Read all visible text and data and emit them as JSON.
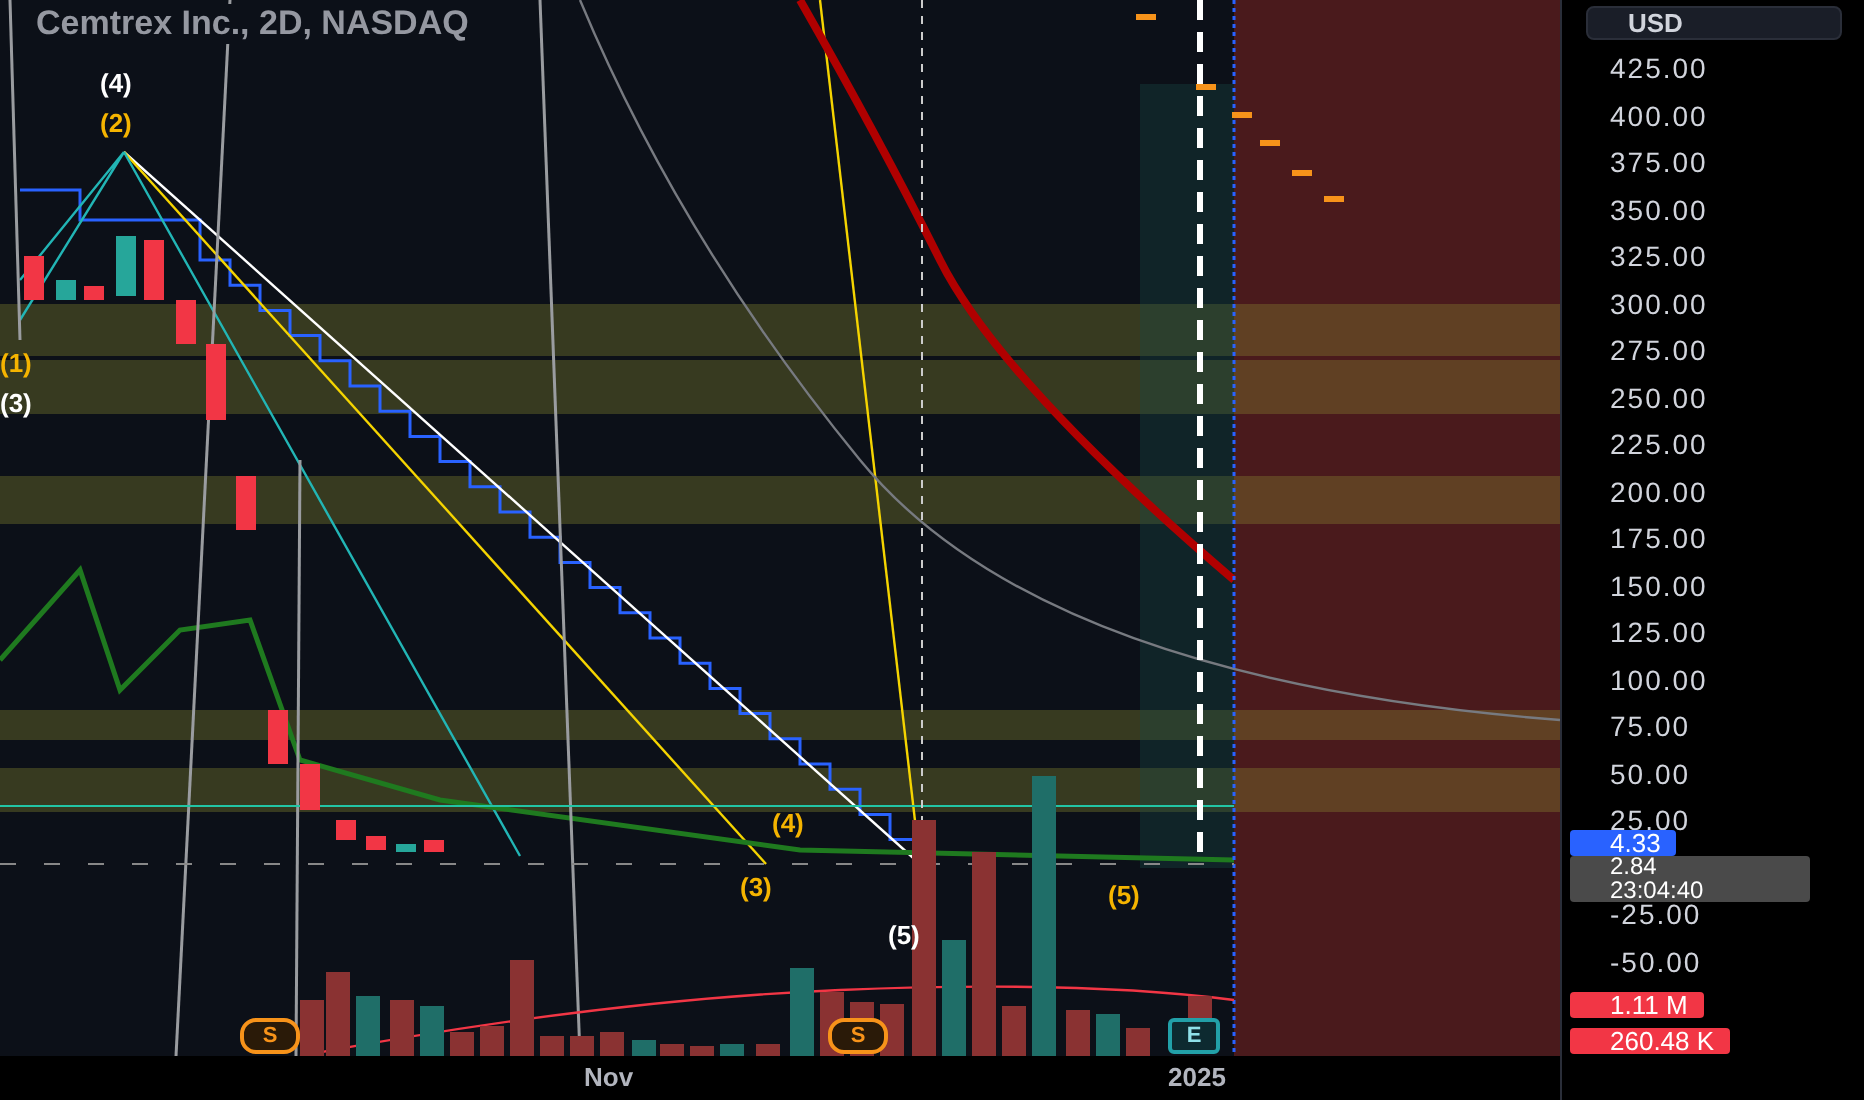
{
  "chart": {
    "title": "Cemtrex Inc., 2D, NASDAQ",
    "wave_labels": [
      {
        "text": "(4)",
        "color": "#ffffff"
      },
      {
        "text": "(2)",
        "color": "#f5b400"
      },
      {
        "text": "(1)",
        "color": "#f5b400"
      },
      {
        "text": "(3)",
        "color": "#ffffff"
      },
      {
        "text": "(4)",
        "color": "#f5b400"
      },
      {
        "text": "(3)",
        "color": "#f5b400"
      },
      {
        "text": "(5)",
        "color": "#ffffff"
      },
      {
        "text": "(5)",
        "color": "#f5b400"
      }
    ],
    "event_markers": [
      {
        "text": "S",
        "kind": "split"
      },
      {
        "text": "S",
        "kind": "split"
      },
      {
        "text": "E",
        "kind": "earnings"
      }
    ]
  },
  "price_axis": {
    "currency": "USD",
    "labels": [
      "425.00",
      "400.00",
      "375.00",
      "350.00",
      "325.00",
      "300.00",
      "275.00",
      "250.00",
      "225.00",
      "200.00",
      "175.00",
      "150.00",
      "125.00",
      "100.00",
      "75.00",
      "50.00",
      "25.00",
      "-25.00",
      "-50.00"
    ],
    "badges": [
      {
        "kind": "price",
        "text": "4.33",
        "color": "#2962ff"
      },
      {
        "kind": "countdown",
        "text": "2.84",
        "subtext": "23:04:40",
        "color": "#4a4a4a"
      },
      {
        "kind": "volume",
        "text": "1.11 M",
        "color": "#f23645"
      },
      {
        "kind": "volume",
        "text": "260.48 K",
        "color": "#f23645"
      }
    ]
  },
  "time_axis": [
    "Nov",
    "2025"
  ]
}
